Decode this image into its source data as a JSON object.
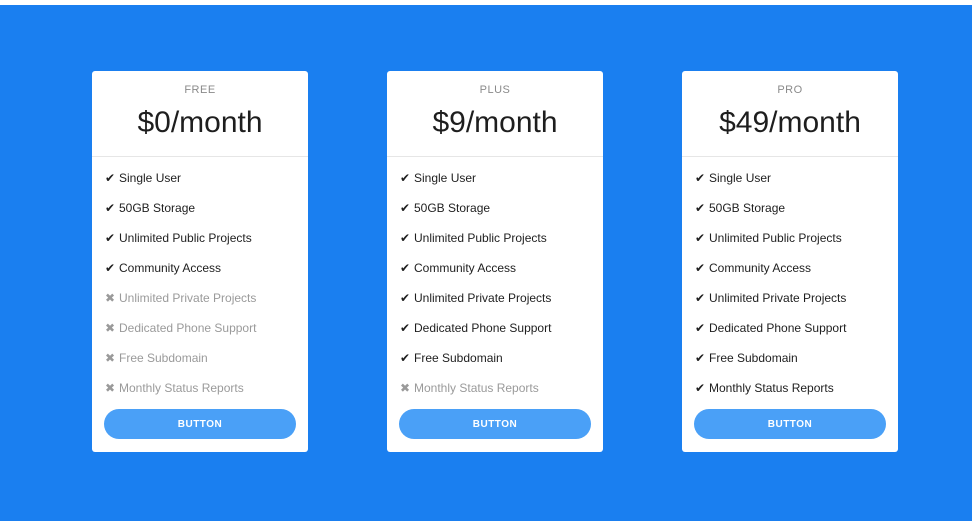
{
  "plans": [
    {
      "name": "FREE",
      "price": "$0/month",
      "button": "BUTTON",
      "features": [
        {
          "label": "Single User",
          "included": true
        },
        {
          "label": "50GB Storage",
          "included": true
        },
        {
          "label": "Unlimited Public Projects",
          "included": true
        },
        {
          "label": "Community Access",
          "included": true
        },
        {
          "label": "Unlimited Private Projects",
          "included": false
        },
        {
          "label": "Dedicated Phone Support",
          "included": false
        },
        {
          "label": "Free Subdomain",
          "included": false
        },
        {
          "label": "Monthly Status Reports",
          "included": false
        }
      ]
    },
    {
      "name": "PLUS",
      "price": "$9/month",
      "button": "BUTTON",
      "features": [
        {
          "label": "Single User",
          "included": true
        },
        {
          "label": "50GB Storage",
          "included": true
        },
        {
          "label": "Unlimited Public Projects",
          "included": true
        },
        {
          "label": "Community Access",
          "included": true
        },
        {
          "label": "Unlimited Private Projects",
          "included": true
        },
        {
          "label": "Dedicated Phone Support",
          "included": true
        },
        {
          "label": "Free Subdomain",
          "included": true
        },
        {
          "label": "Monthly Status Reports",
          "included": false
        }
      ]
    },
    {
      "name": "PRO",
      "price": "$49/month",
      "button": "BUTTON",
      "features": [
        {
          "label": "Single User",
          "included": true
        },
        {
          "label": "50GB Storage",
          "included": true
        },
        {
          "label": "Unlimited Public Projects",
          "included": true
        },
        {
          "label": "Community Access",
          "included": true
        },
        {
          "label": "Unlimited Private Projects",
          "included": true
        },
        {
          "label": "Dedicated Phone Support",
          "included": true
        },
        {
          "label": "Free Subdomain",
          "included": true
        },
        {
          "label": "Monthly Status Reports",
          "included": true
        }
      ]
    }
  ],
  "icons": {
    "included": "check-icon",
    "excluded": "times-icon"
  },
  "colors": {
    "background": "#1a7ff0",
    "button": "#4aa0f7",
    "excluded_text": "#9a9a9a"
  }
}
